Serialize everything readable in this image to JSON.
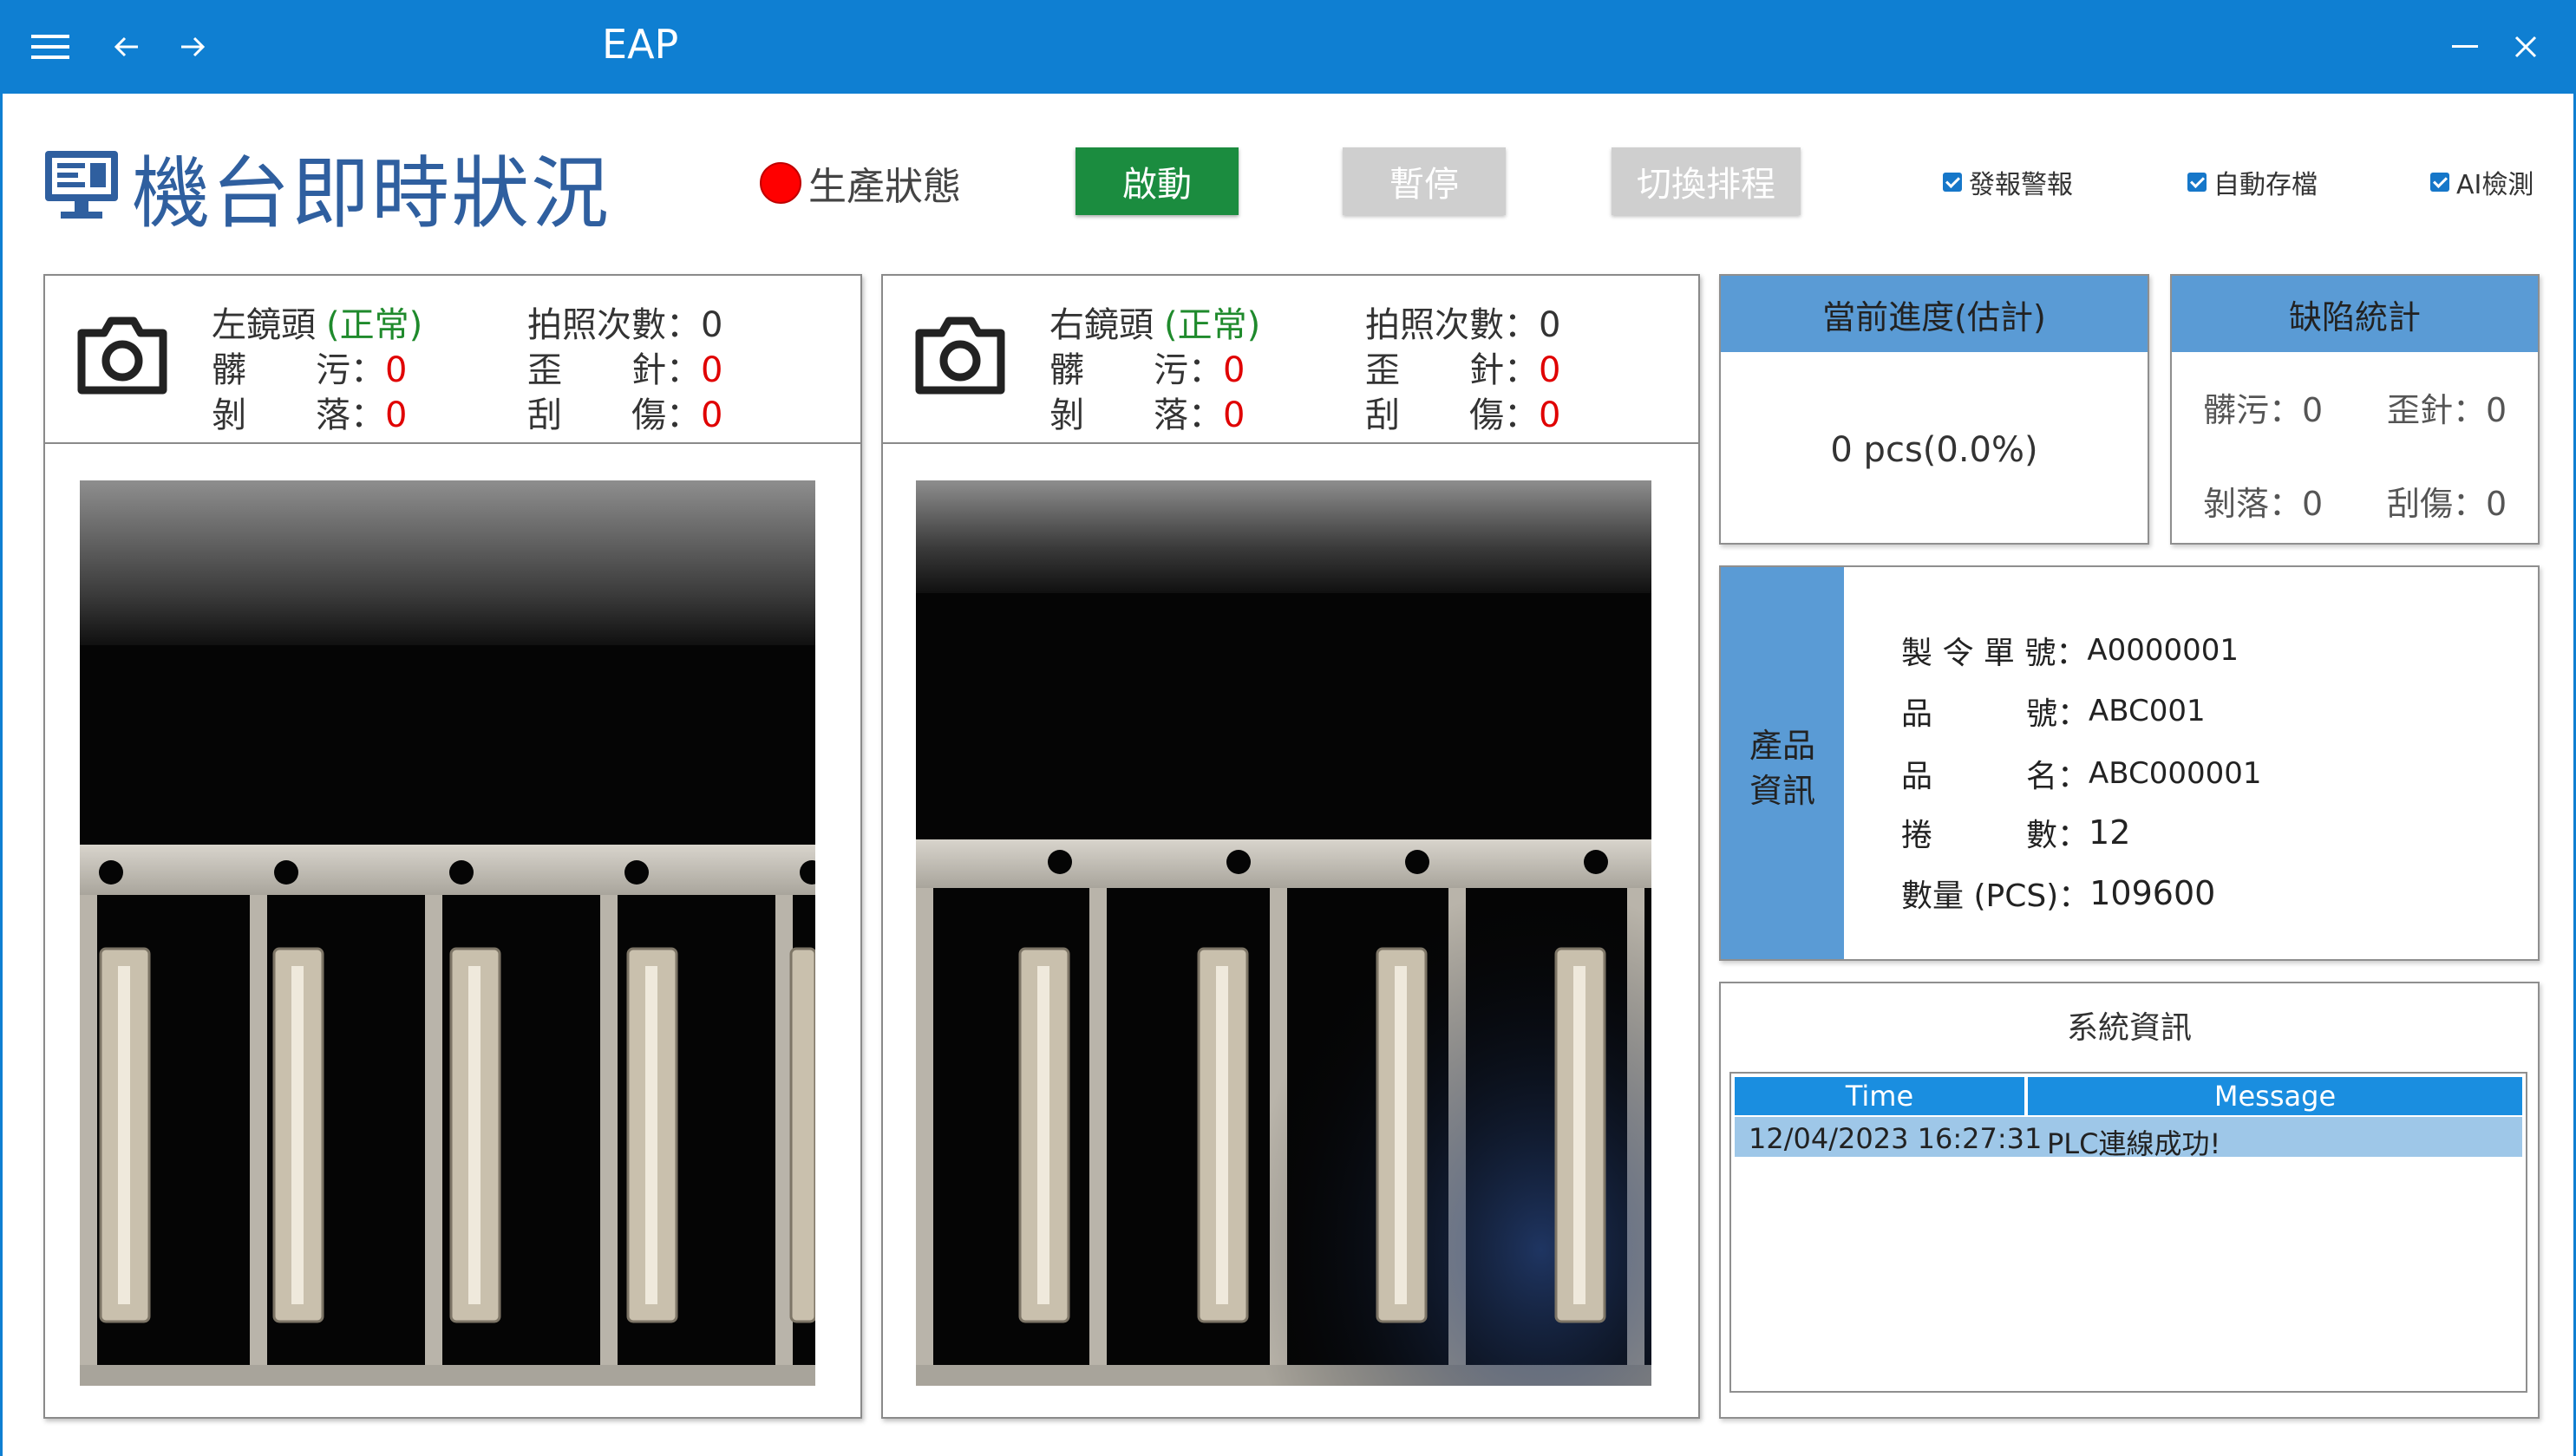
{
  "app": {
    "title": "EAP",
    "icons": [
      "menu-icon",
      "back-arrow-icon",
      "forward-arrow-icon",
      "minimize-icon",
      "close-icon"
    ]
  },
  "header": {
    "page_title": "機台即時狀況",
    "production_status_label": "生產狀態",
    "status_color": "#ff0000",
    "buttons": {
      "start": "啟動",
      "pause": "暫停",
      "switch_schedule": "切換排程"
    },
    "checkboxes": [
      {
        "label": "發報警報",
        "checked": true
      },
      {
        "label": "自動存檔",
        "checked": true
      },
      {
        "label": "AI檢測",
        "checked": true
      }
    ]
  },
  "cameras": [
    {
      "name": "左鏡頭",
      "status": "(正常)",
      "shots_label": "拍照次數：",
      "shots": "0",
      "dirt_label": "髒　　污：",
      "dirt": "0",
      "bent_label": "歪　　針：",
      "bent": "0",
      "peel_label": "剝　　落：",
      "peel": "0",
      "scratch_label": "刮　　傷：",
      "scratch": "0"
    },
    {
      "name": "右鏡頭",
      "status": "(正常)",
      "shots_label": "拍照次數：",
      "shots": "0",
      "dirt_label": "髒　　污：",
      "dirt": "0",
      "bent_label": "歪　　針：",
      "bent": "0",
      "peel_label": "剝　　落：",
      "peel": "0",
      "scratch_label": "刮　　傷：",
      "scratch": "0"
    }
  ],
  "progress": {
    "title": "當前進度(估計)",
    "value": "0 pcs(0.0%)"
  },
  "defects": {
    "title": "缺陷統計",
    "dirt": "髒污：0",
    "bent": "歪針：0",
    "peel": "剝落：0",
    "scratch": "刮傷：0"
  },
  "product": {
    "side_label": "產品\n資訊",
    "rows": [
      {
        "label": "製 令 單 號：",
        "value": "A0000001"
      },
      {
        "label": "品　　　號：",
        "value": "ABC001"
      },
      {
        "label": "品　　　名：",
        "value": "ABC000001"
      },
      {
        "label": "捲　　　數：",
        "value": "12"
      },
      {
        "label": "數量 (PCS)：",
        "value": "109600"
      }
    ]
  },
  "system": {
    "title": "系統資訊",
    "columns": [
      "Time",
      "Message"
    ],
    "rows": [
      {
        "time": "12/04/2023 16:27:31",
        "message": "PLC連線成功!"
      }
    ]
  },
  "colors": {
    "titlebar": "#0f7fd2",
    "accent_header": "#5a9bd5",
    "start_button": "#1b8c3f",
    "ok_text": "#1f8a2c",
    "defect_count": "#e00000"
  }
}
